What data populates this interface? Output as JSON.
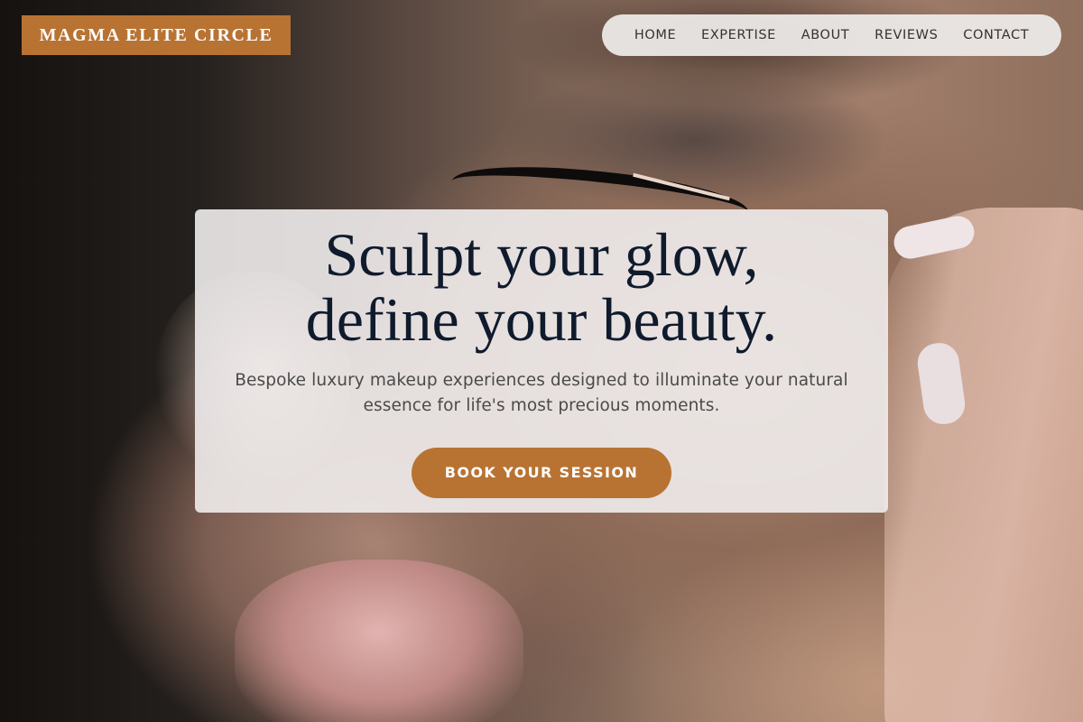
{
  "brand": {
    "logo_text": "MAGMA ELITE CIRCLE"
  },
  "nav": {
    "items": [
      {
        "label": "HOME"
      },
      {
        "label": "EXPERTISE"
      },
      {
        "label": "ABOUT"
      },
      {
        "label": "REVIEWS"
      },
      {
        "label": "CONTACT"
      }
    ]
  },
  "hero": {
    "headline_line1": "Sculpt your glow,",
    "headline_line2": "define your beauty.",
    "subtext": "Bespoke luxury makeup experiences designed to illuminate your natural essence for life's most precious moments.",
    "cta_label": "BOOK YOUR SESSION",
    "background_image": "makeup-application-closeup-photo"
  },
  "colors": {
    "accent": "#b87333",
    "headline": "#0f1b2d",
    "body_text": "#4a4a4a",
    "nav_text": "#333333"
  }
}
